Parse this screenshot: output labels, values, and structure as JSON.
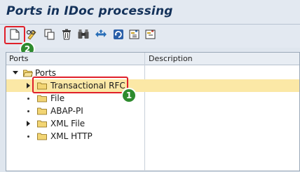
{
  "window": {
    "title": "Ports in IDoc processing"
  },
  "toolbar": {
    "buttons": [
      {
        "name": "create",
        "icon": "new-document-icon"
      },
      {
        "name": "change",
        "icon": "pencil-glasses-icon"
      },
      {
        "name": "copy",
        "icon": "copy-icon"
      },
      {
        "name": "delete",
        "icon": "trash-icon"
      },
      {
        "name": "find",
        "icon": "binoculars-icon"
      },
      {
        "name": "navigate",
        "icon": "arrows-icon"
      },
      {
        "name": "refresh",
        "icon": "refresh-icon"
      },
      {
        "name": "expand",
        "icon": "expand-node-icon"
      },
      {
        "name": "collapse",
        "icon": "collapse-node-icon"
      }
    ]
  },
  "tree": {
    "columns": {
      "ports": "Ports",
      "description": "Description"
    },
    "root": {
      "label": "Ports",
      "expanded": true
    },
    "items": [
      {
        "label": "Transactional RFC",
        "expandable": true,
        "selected": true
      },
      {
        "label": "File",
        "expandable": false
      },
      {
        "label": "ABAP-PI",
        "expandable": false
      },
      {
        "label": "XML File",
        "expandable": true
      },
      {
        "label": "XML HTTP",
        "expandable": false
      }
    ]
  },
  "annotations": {
    "badge_1": "1",
    "badge_2": "2"
  },
  "colors": {
    "callout": "#e0202a",
    "badge": "#2e8b2e",
    "selection": "#fbe8a6",
    "folder": "#f2d574",
    "title": "#14325a"
  }
}
